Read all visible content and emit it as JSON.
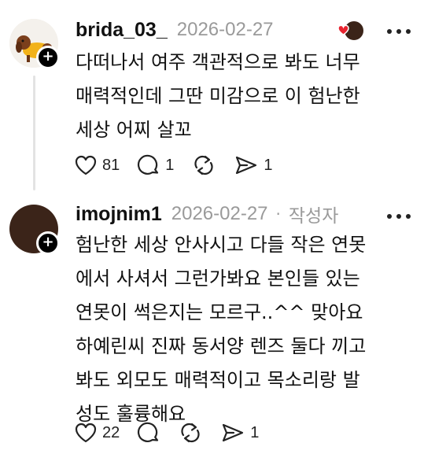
{
  "posts": [
    {
      "username": "brida_03_",
      "timestamp": "2026-02-27",
      "text_lines": [
        "다떠나서 여주 객관적으로 봐도 너무",
        "매력적인데 그딴 미감으로 이 험난한",
        "세상 어찌 살꼬"
      ],
      "likes": "81",
      "replies": "1",
      "shares": "1",
      "liked_by_avatar": "heart-avatar-icon"
    },
    {
      "username": "imojnim1",
      "timestamp": "2026-02-27",
      "separator": "·",
      "author_tag": "작성자",
      "text_lines": [
        "험난한 세상 안사시고 다들 작은 연못",
        "에서 사셔서 그런가봐요 본인들 있는",
        "연못이 썩은지는 모르구..^^ 맞아요",
        "하예린씨 진짜 동서양 렌즈 둘다 끼고",
        "봐도 외모도 매력적이고 목소리랑 발",
        "성도 훌륭해요"
      ],
      "likes": "22",
      "shares": "1"
    }
  ],
  "colors": {
    "heart_red": "#e8232f",
    "muted": "#9a9a9a",
    "line": "#e3e3e3"
  }
}
